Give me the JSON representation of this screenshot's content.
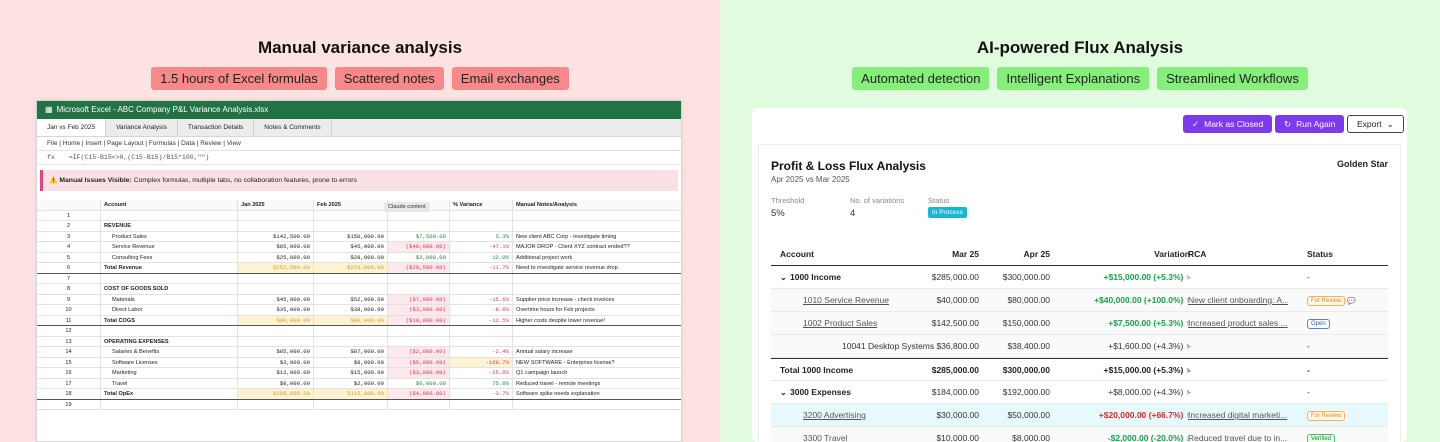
{
  "left": {
    "title": "Manual variance analysis",
    "pills": [
      "1.5 hours of Excel formulas",
      "Scattered notes",
      "Email exchanges"
    ],
    "excel": {
      "window_title": "Microsoft Excel - ABC Company P&L Variance Analysis.xlsx",
      "tabs": [
        "Jan vs Feb 2025",
        "Variance Analysis",
        "Transaction Details",
        "Notes & Comments"
      ],
      "menubar": "File | Home | Insert | Page Layout | Formulas | Data | Review | View",
      "formula_label": "fx",
      "formula": "=IF(C15-B15<>0,(C15-B15)/B15*100,\"\")",
      "warning_bold": "Manual Issues Visible:",
      "warning_text": "Complex formulas, multiple tabs, no collaboration features, prone to errors",
      "tooltip": "Claude content",
      "headers": [
        "",
        "Account",
        "Jan 2025",
        "Feb 2025",
        "",
        "% Variance",
        "Manual Notes/Analysis"
      ],
      "rows": [
        {
          "n": "1",
          "account": "",
          "jan": "",
          "feb": "",
          "diff": "",
          "pct": "",
          "note": ""
        },
        {
          "n": "2",
          "account": "REVENUE",
          "jan": "",
          "feb": "",
          "diff": "",
          "pct": "",
          "note": ""
        },
        {
          "n": "3",
          "account": "Product Sales",
          "jan": "$142,500.00",
          "feb": "$150,000.00",
          "diff": "$7,500.00",
          "pct": "5.3%",
          "note": "New client ABC Corp - investigate timing"
        },
        {
          "n": "4",
          "account": "Service Revenue",
          "jan": "$85,000.00",
          "feb": "$45,000.00",
          "diff": "($40,000.00)",
          "pct": "-47.1%",
          "note": "MAJOR DROP - Client XYZ contract ended??"
        },
        {
          "n": "5",
          "account": "Consulting Fees",
          "jan": "$25,000.00",
          "feb": "$28,000.00",
          "diff": "$3,000.00",
          "pct": "12.0%",
          "note": "Additional project work"
        },
        {
          "n": "6",
          "account": "Total Revenue",
          "jan": "$252,500.00",
          "feb": "$223,000.00",
          "diff": "($29,500.00)",
          "pct": "-11.7%",
          "note": "Need to investigate service revenue drop"
        },
        {
          "n": "7",
          "account": "",
          "jan": "",
          "feb": "",
          "diff": "",
          "pct": "",
          "note": ""
        },
        {
          "n": "8",
          "account": "COST OF GOODS SOLD",
          "jan": "",
          "feb": "",
          "diff": "",
          "pct": "",
          "note": ""
        },
        {
          "n": "9",
          "account": "Materials",
          "jan": "$45,000.00",
          "feb": "$52,000.00",
          "diff": "($7,000.00)",
          "pct": "-15.6%",
          "note": "Supplier price increase - check invoices"
        },
        {
          "n": "10",
          "account": "Direct Labor",
          "jan": "$35,000.00",
          "feb": "$38,000.00",
          "diff": "($3,000.00)",
          "pct": "-8.6%",
          "note": "Overtime hours for Feb projects"
        },
        {
          "n": "11",
          "account": "Total COGS",
          "jan": "$80,000.00",
          "feb": "$90,000.00",
          "diff": "($10,000.00)",
          "pct": "-12.5%",
          "note": "Higher costs despite lower revenue!"
        },
        {
          "n": "12",
          "account": "",
          "jan": "",
          "feb": "",
          "diff": "",
          "pct": "",
          "note": ""
        },
        {
          "n": "13",
          "account": "OPERATING EXPENSES",
          "jan": "",
          "feb": "",
          "diff": "",
          "pct": "",
          "note": ""
        },
        {
          "n": "14",
          "account": "Salaries & Benefits",
          "jan": "$85,000.00",
          "feb": "$87,000.00",
          "diff": "($2,000.00)",
          "pct": "-2.4%",
          "note": "Annual salary increase"
        },
        {
          "n": "15",
          "account": "Software Licenses",
          "jan": "$3,000.00",
          "feb": "$8,000.00",
          "diff": "($5,000.00)",
          "pct": "-166.7%",
          "note": "NEW SOFTWARE - Enterprise license?"
        },
        {
          "n": "16",
          "account": "Marketing",
          "jan": "$12,000.00",
          "feb": "$15,000.00",
          "diff": "($3,000.00)",
          "pct": "-25.0%",
          "note": "Q1 campaign launch"
        },
        {
          "n": "17",
          "account": "Travel",
          "jan": "$8,000.00",
          "feb": "$2,000.00",
          "diff": "$6,000.00",
          "pct": "75.0%",
          "note": "Reduced travel - remote meetings"
        },
        {
          "n": "18",
          "account": "Total OpEx",
          "jan": "$108,000.00",
          "feb": "$112,000.00",
          "diff": "($4,000.00)",
          "pct": "-3.7%",
          "note": "Software spike needs explanation"
        },
        {
          "n": "19",
          "account": "",
          "jan": "",
          "feb": "",
          "diff": "",
          "pct": "",
          "note": ""
        }
      ]
    }
  },
  "right": {
    "title": "AI-powered Flux Analysis",
    "pills": [
      "Automated detection",
      "Intelligent Explanations",
      "Streamlined Workflows"
    ],
    "flux": {
      "buttons": {
        "mark_closed": "Mark as Closed",
        "run_again": "Run Again",
        "export": "Export"
      },
      "title": "Profit & Loss Flux Analysis",
      "subtitle": "Apr 2025 vs Mar 2025",
      "company": "Golden Star",
      "meta": {
        "threshold_label": "Threshold",
        "threshold_value": "5%",
        "variations_label": "No. of variations",
        "variations_value": "4",
        "status_label": "Status",
        "status_value": "In Process"
      },
      "headers": [
        "Account",
        "Mar 25",
        "Apr 25",
        "Variation",
        "RCA",
        "Status"
      ],
      "rows": [
        {
          "account": "1000 Income",
          "mar": "$285,000.00",
          "apr": "$300,000.00",
          "var": "+$15,000.00 (+5.3%) ↑",
          "rca": "-",
          "status": "-"
        },
        {
          "account": "1010 Service Revenue",
          "mar": "$40,000.00",
          "apr": "$80,000.00",
          "var": "+$40,000.00 (+100.0%) ↑",
          "rca": "New client onboarding: A...",
          "status": "For Review"
        },
        {
          "account": "1002 Product Sales",
          "mar": "$142,500.00",
          "apr": "$150,000.00",
          "var": "+$7,500.00 (+5.3%) ↑",
          "rca": "Increased product sales ...",
          "status": "Open"
        },
        {
          "account": "10041 Desktop Systems",
          "mar": "$36,800.00",
          "apr": "$38,400.00",
          "var": "+$1,600.00 (+4.3%) ↑",
          "rca": "-",
          "status": "-"
        },
        {
          "account": "Total 1000 Income",
          "mar": "$285,000.00",
          "apr": "$300,000.00",
          "var": "+$15,000.00 (+5.3%) ↑",
          "rca": "-",
          "status": "-"
        },
        {
          "account": "3000 Expenses",
          "mar": "$184,000.00",
          "apr": "$192,000.00",
          "var": "+$8,000.00 (+4.3%) ↑",
          "rca": "-",
          "status": "-"
        },
        {
          "account": "3200 Advertising",
          "mar": "$30,000.00",
          "apr": "$50,000.00",
          "var": "+$20,000.00 (+66.7%) ↑",
          "rca": "Increased digital marketi...",
          "status": "For Review"
        },
        {
          "account": "3300 Travel",
          "mar": "$10,000.00",
          "apr": "$8,000.00",
          "var": "-$2,000.00 (-20.0%) ↓",
          "rca": "Reduced travel due to in...",
          "status": "Verified"
        }
      ]
    }
  }
}
